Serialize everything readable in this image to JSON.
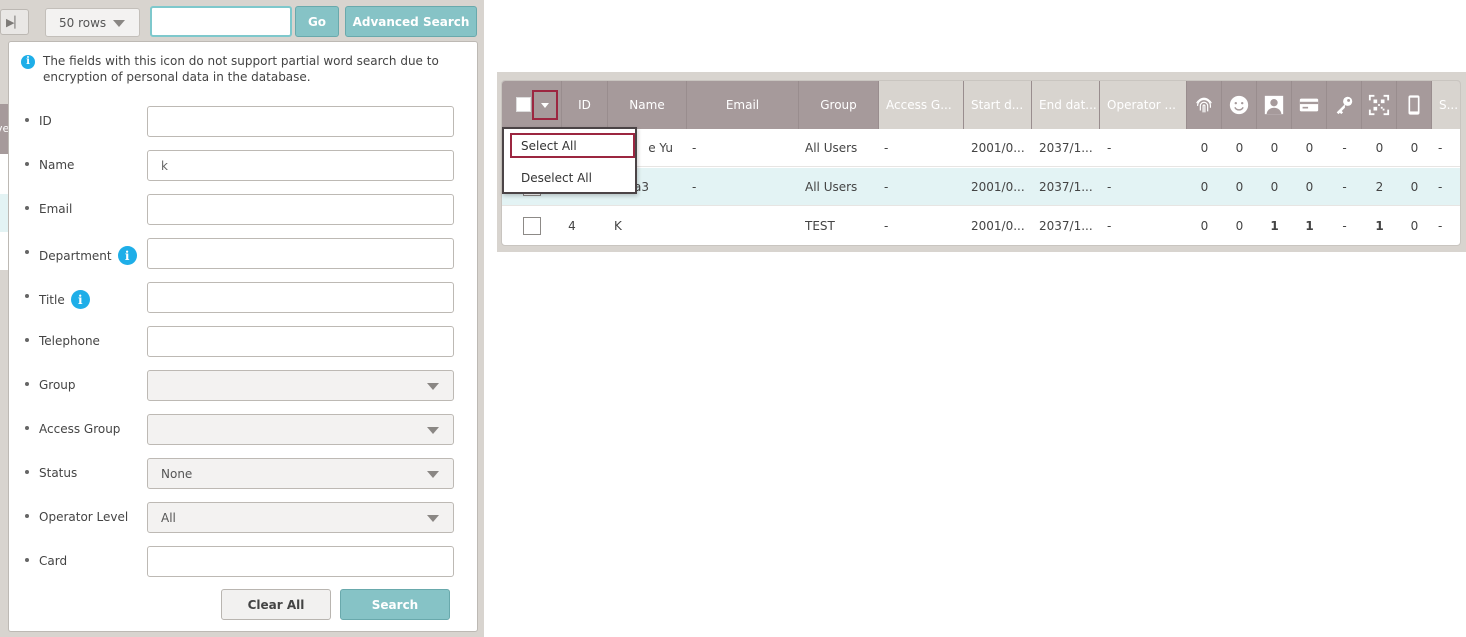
{
  "toolbar": {
    "rows_label": "50 rows",
    "quick_search_value": "",
    "go_label": "Go",
    "advanced_label": "Advanced Search"
  },
  "advanced": {
    "notice": "The fields with this icon do not support partial word search due to encryption of personal data in the database.",
    "info_glyph": "i",
    "fields": {
      "id": {
        "label": "ID",
        "value": ""
      },
      "name": {
        "label": "Name",
        "value": "k"
      },
      "email": {
        "label": "Email",
        "value": ""
      },
      "department": {
        "label": "Department",
        "value": ""
      },
      "title": {
        "label": "Title",
        "value": ""
      },
      "telephone": {
        "label": "Telephone",
        "value": ""
      },
      "group": {
        "label": "Group",
        "value": ""
      },
      "access_group": {
        "label": "Access Group",
        "value": ""
      },
      "status": {
        "label": "Status",
        "value": "None"
      },
      "operator_level": {
        "label": "Operator Level",
        "value": "All"
      },
      "card": {
        "label": "Card",
        "value": ""
      }
    },
    "clear_label": "Clear All",
    "search_label": "Search"
  },
  "table": {
    "columns": {
      "id": "ID",
      "name": "Name",
      "email": "Email",
      "group": "Group",
      "access_group": "Access G...",
      "start_date": "Start d...",
      "end_date": "End dat...",
      "operator": "Operator ...",
      "status": "S..."
    },
    "icons": [
      "fingerprint-icon",
      "face-icon",
      "photo-icon",
      "card-icon",
      "key-icon",
      "qr-icon",
      "mobile-icon"
    ],
    "rows": [
      {
        "id": "",
        "name": "e Yu",
        "email": "-",
        "group": "All Users",
        "access": "-",
        "start": "2001/0...",
        "end": "2037/1...",
        "operator": "-",
        "fp": "0",
        "face": "0",
        "photo": "0",
        "card": "0",
        "key": "-",
        "qr": "0",
        "mobile": "0",
        "status": "-"
      },
      {
        "id": "",
        "name": "a3",
        "email": "-",
        "group": "All Users",
        "access": "-",
        "start": "2001/0...",
        "end": "2037/1...",
        "operator": "-",
        "fp": "0",
        "face": "0",
        "photo": "0",
        "card": "0",
        "key": "-",
        "qr": "2",
        "mobile": "0",
        "status": "-"
      },
      {
        "id": "4",
        "name": "K",
        "email": "",
        "group": "TEST",
        "access": "-",
        "start": "2001/0...",
        "end": "2037/1...",
        "operator": "-",
        "fp": "0",
        "face": "0",
        "photo": "1",
        "card": "1",
        "key": "-",
        "qr": "1",
        "mobile": "0",
        "status": "-"
      }
    ]
  },
  "dropdown": {
    "select_all": "Select All",
    "deselect_all": "Deselect All"
  },
  "colors": {
    "header_bg": "#a69a9b",
    "accent_teal": "#86c3c6",
    "highlight_border": "#9c2640",
    "row_highlight": "#e3f3f4"
  }
}
